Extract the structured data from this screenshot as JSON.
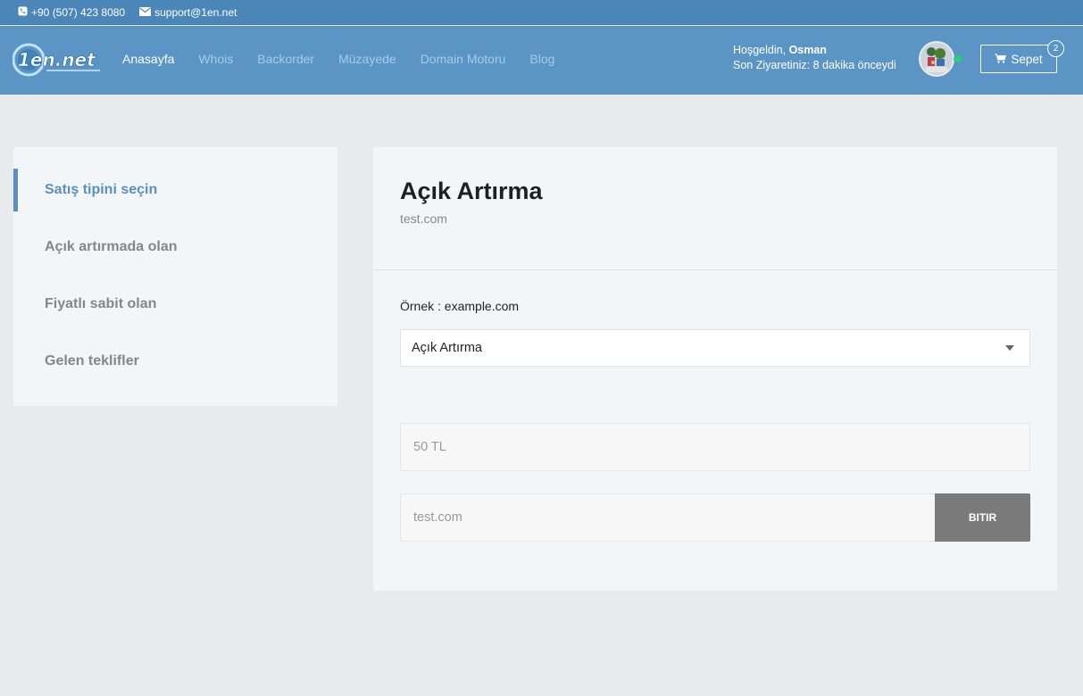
{
  "topbar": {
    "phone": "+90 (507) 423 8080",
    "email": "support@1en.net",
    "phone_icon": "phone-icon",
    "email_icon": "envelope-icon"
  },
  "header": {
    "logo_text": "1en.net",
    "nav": [
      {
        "label": "Anasayfa",
        "active": true
      },
      {
        "label": "Whois"
      },
      {
        "label": "Backorder"
      },
      {
        "label": "Müzayede"
      },
      {
        "label": "Domain Motoru"
      },
      {
        "label": "Blog"
      }
    ],
    "welcome_prefix": "Hoşgeldin,",
    "username": "Osman",
    "last_visit": "Son Ziyaretiniz: 8 dakika önceydi",
    "cart_label": "Sepet",
    "cart_count": "2",
    "cart_icon": "shopping-cart-icon",
    "online_status_color": "#22d36b"
  },
  "sidebar": {
    "items": [
      {
        "label": "Satış tipini seçin",
        "active": true
      },
      {
        "label": "Açık artırmada olan"
      },
      {
        "label": "Fiyatlı sabit olan"
      },
      {
        "label": "Gelen teklifler"
      }
    ]
  },
  "main": {
    "title": "Açık Artırma",
    "subtitle": "test.com",
    "example_label": "Örnek : example.com",
    "sale_type": {
      "selected": "Açık Artırma"
    },
    "price_placeholder": "50 TL",
    "domain_placeholder": "test.com",
    "finish_button": "BITIR"
  },
  "colors": {
    "topbar_bg": "#4a87b8",
    "navbar_bg": "#5b95c5",
    "accent": "#5b8fbd",
    "button_bg": "#7a7a7a"
  }
}
